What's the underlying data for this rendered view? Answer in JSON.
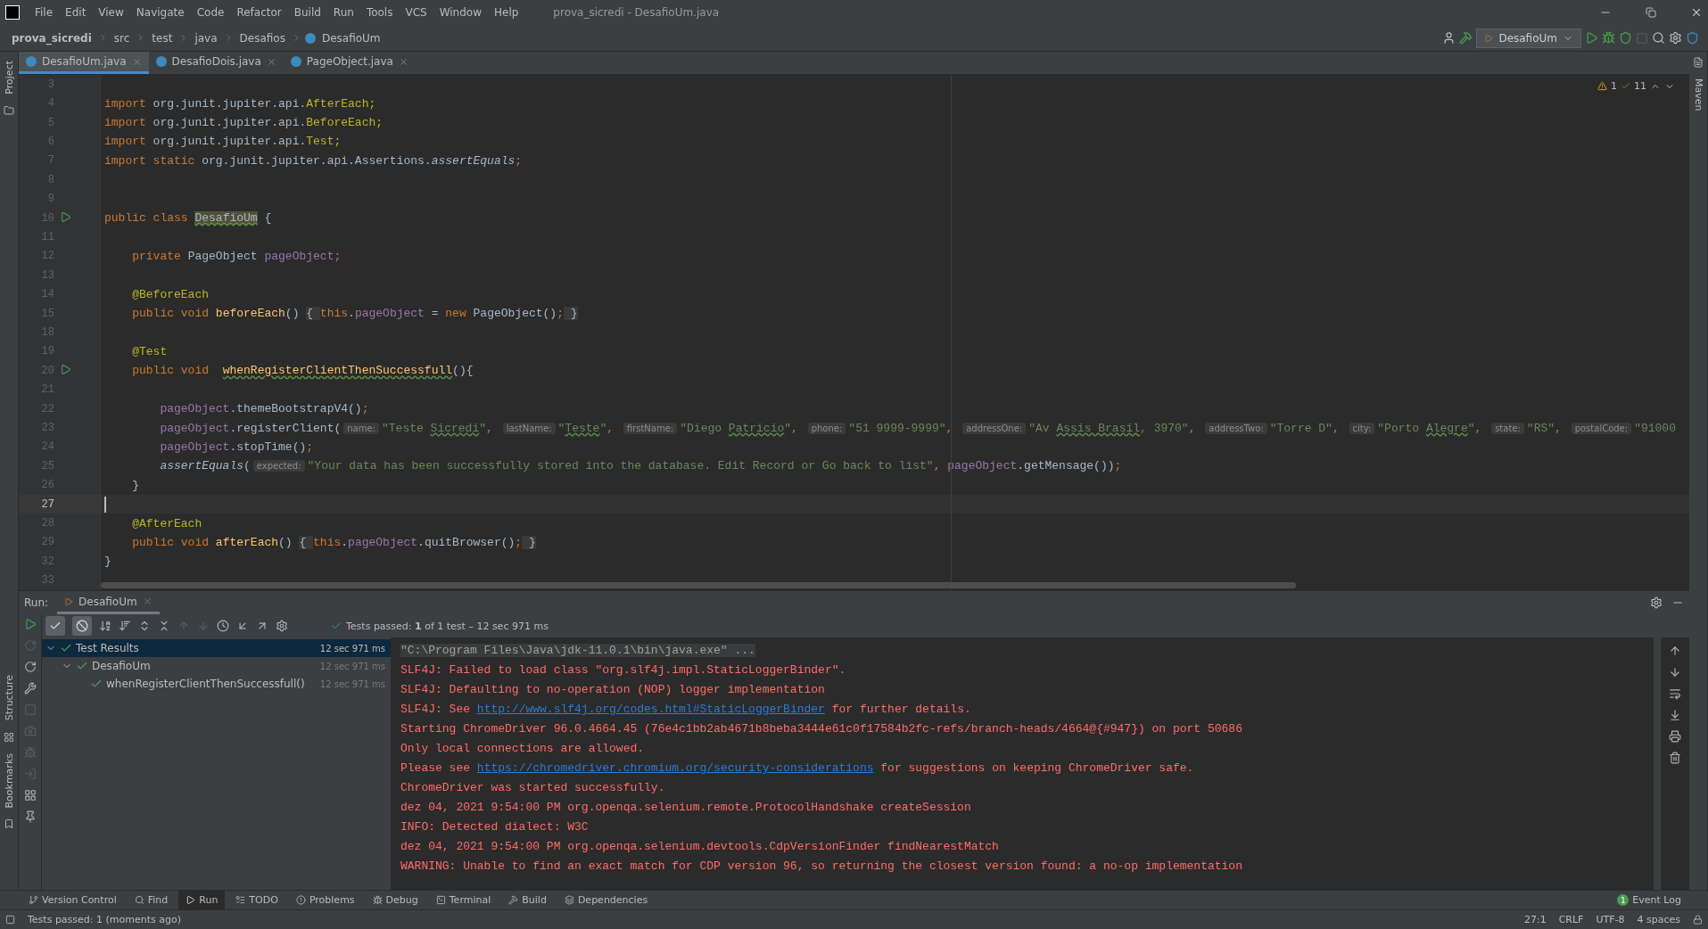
{
  "menu": [
    "File",
    "Edit",
    "View",
    "Navigate",
    "Code",
    "Refactor",
    "Build",
    "Run",
    "Tools",
    "VCS",
    "Window",
    "Help"
  ],
  "window_title": "prova_sicredi - DesafioUm.java",
  "breadcrumbs": [
    "prova_sicredi",
    "src",
    "test",
    "java",
    "Desafios",
    "DesafioUm"
  ],
  "run_config": "DesafioUm",
  "left_strip": [
    {
      "label": "Project"
    },
    {
      "label": "Structure"
    },
    {
      "label": "Bookmarks"
    }
  ],
  "right_strip": [
    {
      "label": "Maven"
    }
  ],
  "editor_tabs": [
    {
      "label": "DesafioUm.java",
      "selected": true
    },
    {
      "label": "DesafioDois.java",
      "selected": false
    },
    {
      "label": "PageObject.java",
      "selected": false
    }
  ],
  "inspections": {
    "warnings": "1",
    "weak_warnings": "11"
  },
  "code_lines": [
    {
      "num": "3",
      "run_icon": false,
      "current": false
    },
    {
      "num": "4",
      "run_icon": false,
      "current": false,
      "tokens": [
        {
          "kind": "kw",
          "text": "import "
        },
        {
          "kind": "plain",
          "text": "org.junit.jupiter.api."
        },
        {
          "kind": "ann",
          "text": "AfterEach;"
        }
      ]
    },
    {
      "num": "5",
      "run_icon": false,
      "current": false,
      "tokens": [
        {
          "kind": "kw",
          "text": "import "
        },
        {
          "kind": "plain",
          "text": "org.junit.jupiter.api."
        },
        {
          "kind": "ann",
          "text": "BeforeEach;"
        }
      ]
    },
    {
      "num": "6",
      "run_icon": false,
      "current": false,
      "tokens": [
        {
          "kind": "kw",
          "text": "import "
        },
        {
          "kind": "plain",
          "text": "org.junit.jupiter.api."
        },
        {
          "kind": "ann",
          "text": "Test;"
        }
      ]
    },
    {
      "num": "7",
      "run_icon": false,
      "current": false,
      "tokens": [
        {
          "kind": "kw",
          "text": "import static "
        },
        {
          "kind": "plain",
          "text": "org.junit.jupiter.api.Assertions."
        },
        {
          "kind": "italic",
          "text": "assertEquals"
        },
        {
          "kind": "kw",
          "text": ";"
        }
      ]
    },
    {
      "num": "8",
      "run_icon": false,
      "current": false
    },
    {
      "num": "9",
      "run_icon": false,
      "current": false
    },
    {
      "num": "10",
      "run_icon": true,
      "current": false,
      "tokens": [
        {
          "kind": "kw",
          "text": "public class "
        },
        {
          "kind": "cls_hl",
          "text": "DesafioUm"
        },
        {
          "kind": "plain",
          "text": " {"
        }
      ]
    },
    {
      "num": "11",
      "run_icon": false,
      "current": false
    },
    {
      "num": "12",
      "run_icon": false,
      "current": false,
      "tokens": [
        {
          "kind": "kw",
          "text": "    private "
        },
        {
          "kind": "plain",
          "text": "PageObject "
        },
        {
          "kind": "field",
          "text": "pageObject"
        },
        {
          "kind": "kw",
          "text": ";"
        }
      ]
    },
    {
      "num": "13",
      "run_icon": false,
      "current": false
    },
    {
      "num": "14",
      "run_icon": false,
      "current": false,
      "tokens": [
        {
          "kind": "ann",
          "text": "    @BeforeEach"
        }
      ]
    },
    {
      "num": "15",
      "run_icon": false,
      "current": false,
      "tokens": [
        {
          "kind": "kw",
          "text": "    public void "
        },
        {
          "kind": "decl",
          "text": "beforeEach"
        },
        {
          "kind": "plain",
          "text": "() "
        },
        {
          "kind": "fold",
          "text": "{ "
        },
        {
          "kind": "kw",
          "text": "this"
        },
        {
          "kind": "plain",
          "text": "."
        },
        {
          "kind": "field",
          "text": "pageObject"
        },
        {
          "kind": "plain",
          "text": " = "
        },
        {
          "kind": "kw",
          "text": "new "
        },
        {
          "kind": "plain",
          "text": "PageObject()"
        },
        {
          "kind": "kw",
          "text": ";"
        },
        {
          "kind": "fold",
          "text": " }"
        }
      ]
    },
    {
      "num": "18",
      "run_icon": false,
      "current": false
    },
    {
      "num": "19",
      "run_icon": false,
      "current": false,
      "tokens": [
        {
          "kind": "ann",
          "text": "    @Test"
        }
      ]
    },
    {
      "num": "20",
      "run_icon": true,
      "current": false,
      "tokens": [
        {
          "kind": "kw",
          "text": "    public void  "
        },
        {
          "kind": "decl_typo",
          "text": "whenRegisterClientThenSuccessfull"
        },
        {
          "kind": "plain",
          "text": "(){"
        }
      ]
    },
    {
      "num": "21",
      "run_icon": false,
      "current": false
    },
    {
      "num": "22",
      "run_icon": false,
      "current": false,
      "tokens": [
        {
          "kind": "field",
          "text": "        pageObject"
        },
        {
          "kind": "plain",
          "text": ".themeBootstrapV4()"
        },
        {
          "kind": "kw",
          "text": ";"
        }
      ]
    },
    {
      "num": "23",
      "run_icon": false,
      "current": false,
      "tokens": [
        {
          "kind": "field",
          "text": "        pageObject"
        },
        {
          "kind": "plain",
          "text": ".registerClient("
        },
        {
          "kind": "hint",
          "text": "name:"
        },
        {
          "kind": "str",
          "text": "\"Teste "
        },
        {
          "kind": "str_typo",
          "text": "Sicredi"
        },
        {
          "kind": "str",
          "text": "\""
        },
        {
          "kind": "kw",
          "text": ", "
        },
        {
          "kind": "hint",
          "text": "lastName:"
        },
        {
          "kind": "str",
          "text": "\""
        },
        {
          "kind": "str_typo",
          "text": "Teste"
        },
        {
          "kind": "str",
          "text": "\""
        },
        {
          "kind": "kw",
          "text": ", "
        },
        {
          "kind": "hint",
          "text": "firstName:"
        },
        {
          "kind": "str",
          "text": "\"Diego "
        },
        {
          "kind": "str_typo",
          "text": "Patricio"
        },
        {
          "kind": "str",
          "text": "\""
        },
        {
          "kind": "kw",
          "text": ", "
        },
        {
          "kind": "hint",
          "text": "phone:"
        },
        {
          "kind": "str",
          "text": "\"51 9999-9999\""
        },
        {
          "kind": "kw",
          "text": ", "
        },
        {
          "kind": "hint",
          "text": "addressOne:"
        },
        {
          "kind": "str",
          "text": "\"Av "
        },
        {
          "kind": "str_typo",
          "text": "Assis Brasil"
        },
        {
          "kind": "str",
          "text": ", 3970\""
        },
        {
          "kind": "kw",
          "text": ", "
        },
        {
          "kind": "hint",
          "text": "addressTwo:"
        },
        {
          "kind": "str",
          "text": "\"Torre D\""
        },
        {
          "kind": "kw",
          "text": ", "
        },
        {
          "kind": "hint",
          "text": "city:"
        },
        {
          "kind": "str",
          "text": "\"Porto "
        },
        {
          "kind": "str_typo",
          "text": "Alegre"
        },
        {
          "kind": "str",
          "text": "\""
        },
        {
          "kind": "kw",
          "text": ", "
        },
        {
          "kind": "hint",
          "text": "state:"
        },
        {
          "kind": "str",
          "text": "\"RS\""
        },
        {
          "kind": "kw",
          "text": ", "
        },
        {
          "kind": "hint",
          "text": "postalCode:"
        },
        {
          "kind": "str",
          "text": "\"91000"
        }
      ]
    },
    {
      "num": "24",
      "run_icon": false,
      "current": false,
      "tokens": [
        {
          "kind": "field",
          "text": "        pageObject"
        },
        {
          "kind": "plain",
          "text": ".stopTime()"
        },
        {
          "kind": "kw",
          "text": ";"
        }
      ]
    },
    {
      "num": "25",
      "run_icon": false,
      "current": false,
      "tokens": [
        {
          "kind": "italic",
          "text": "        assertEquals"
        },
        {
          "kind": "plain",
          "text": "("
        },
        {
          "kind": "hint",
          "text": "expected:"
        },
        {
          "kind": "str",
          "text": "\"Your data has been successfully stored into the database. Edit Record or Go back to list\""
        },
        {
          "kind": "kw",
          "text": ", "
        },
        {
          "kind": "field",
          "text": "pageObject"
        },
        {
          "kind": "plain",
          "text": ".getMensage())"
        },
        {
          "kind": "kw",
          "text": ";"
        }
      ]
    },
    {
      "num": "26",
      "run_icon": false,
      "current": false,
      "tokens": [
        {
          "kind": "plain",
          "text": "    }"
        }
      ]
    },
    {
      "num": "27",
      "run_icon": false,
      "current": true
    },
    {
      "num": "28",
      "run_icon": false,
      "current": false,
      "tokens": [
        {
          "kind": "ann",
          "text": "    @AfterEach"
        }
      ]
    },
    {
      "num": "29",
      "run_icon": false,
      "current": false,
      "tokens": [
        {
          "kind": "kw",
          "text": "    public void "
        },
        {
          "kind": "decl",
          "text": "afterEach"
        },
        {
          "kind": "plain",
          "text": "() "
        },
        {
          "kind": "fold",
          "text": "{ "
        },
        {
          "kind": "kw",
          "text": "this"
        },
        {
          "kind": "plain",
          "text": "."
        },
        {
          "kind": "field",
          "text": "pageObject"
        },
        {
          "kind": "plain",
          "text": ".quitBrowser()"
        },
        {
          "kind": "kw",
          "text": ";"
        },
        {
          "kind": "fold",
          "text": " }"
        }
      ]
    },
    {
      "num": "32",
      "run_icon": false,
      "current": false,
      "tokens": [
        {
          "kind": "plain",
          "text": "}"
        }
      ]
    },
    {
      "num": "33",
      "run_icon": false,
      "current": false
    }
  ],
  "run_panel": {
    "label": "Run:",
    "tab": "DesafioUm",
    "status": "Tests passed: **1** of 1 test – 12 sec 971 ms",
    "tree": [
      {
        "label": "Test Results",
        "time": "12 sec 971 ms",
        "selected": true,
        "children": [
          {
            "label": "DesafioUm",
            "time": "12 sec 971 ms",
            "selected": false,
            "children": [
              {
                "label": "whenRegisterClientThenSuccessfull()",
                "time": "12 sec 971 ms",
                "selected": false
              }
            ]
          }
        ]
      }
    ],
    "console": [
      {
        "kind": "command",
        "segments": [
          {
            "text": "\"C:\\Program Files\\Java\\jdk-11.0.1\\bin\\java.exe\" ...",
            "link": false
          }
        ]
      },
      {
        "kind": "error",
        "segments": [
          {
            "text": "SLF4J: Failed to load class \"org.slf4j.impl.StaticLoggerBinder\".",
            "link": false
          }
        ]
      },
      {
        "kind": "error",
        "segments": [
          {
            "text": "SLF4J: Defaulting to no-operation (NOP) logger implementation",
            "link": false
          }
        ]
      },
      {
        "kind": "error",
        "segments": [
          {
            "text": "SLF4J: See ",
            "link": false
          },
          {
            "text": "http://www.slf4j.org/codes.html#StaticLoggerBinder",
            "link": true
          },
          {
            "text": " for further details.",
            "link": false
          }
        ]
      },
      {
        "kind": "error",
        "segments": [
          {
            "text": "Starting ChromeDriver 96.0.4664.45 (76e4c1bb2ab4671b8beba3444e61c0f17584b2fc-refs/branch-heads/4664@{#947}) on port 50686",
            "link": false
          }
        ]
      },
      {
        "kind": "error",
        "segments": [
          {
            "text": "Only local connections are allowed.",
            "link": false
          }
        ]
      },
      {
        "kind": "error",
        "segments": [
          {
            "text": "Please see ",
            "link": false
          },
          {
            "text": "https://chromedriver.chromium.org/security-considerations",
            "link": true
          },
          {
            "text": " for suggestions on keeping ChromeDriver safe.",
            "link": false
          }
        ]
      },
      {
        "kind": "error",
        "segments": [
          {
            "text": "ChromeDriver was started successfully.",
            "link": false
          }
        ]
      },
      {
        "kind": "error",
        "segments": [
          {
            "text": "dez 04, 2021 9:54:00 PM org.openqa.selenium.remote.ProtocolHandshake createSession",
            "link": false
          }
        ]
      },
      {
        "kind": "error",
        "segments": [
          {
            "text": "INFO: Detected dialect: W3C",
            "link": false
          }
        ]
      },
      {
        "kind": "error",
        "segments": [
          {
            "text": "dez 04, 2021 9:54:00 PM org.openqa.selenium.devtools.CdpVersionFinder findNearestMatch",
            "link": false
          }
        ]
      },
      {
        "kind": "error",
        "segments": [
          {
            "text": "WARNING: Unable to find an exact match for CDP version 96, so returning the closest version found: a no-op implementation",
            "link": false
          }
        ]
      }
    ]
  },
  "tool_windows": [
    {
      "label": "Version Control",
      "kind": "vcs",
      "selected": false
    },
    {
      "label": "Find",
      "kind": "find",
      "selected": false
    },
    {
      "label": "Run",
      "kind": "run",
      "selected": true
    },
    {
      "label": "TODO",
      "kind": "todo",
      "selected": false
    },
    {
      "label": "Problems",
      "kind": "problems",
      "selected": false
    },
    {
      "label": "Debug",
      "kind": "debug",
      "selected": false
    },
    {
      "label": "Terminal",
      "kind": "terminal",
      "selected": false
    },
    {
      "label": "Build",
      "kind": "build",
      "selected": false
    },
    {
      "label": "Dependencies",
      "kind": "deps",
      "selected": false
    }
  ],
  "event_log": {
    "label": "Event Log",
    "badge": "1"
  },
  "status_bar": {
    "message": "Tests passed: 1 (moments ago)",
    "items": [
      "27:1",
      "CRLF",
      "UTF-8",
      "4 spaces"
    ]
  }
}
